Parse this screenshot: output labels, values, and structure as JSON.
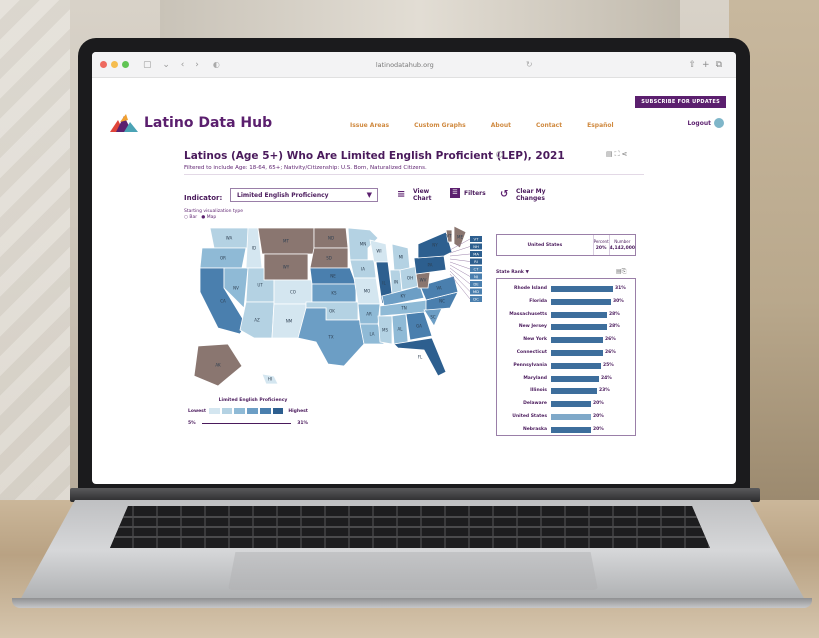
{
  "browser": {
    "url": "latinodatahub.org"
  },
  "site": {
    "subscribe_label": "SUBSCRIBE FOR UPDATES",
    "logo_text": "Latino Data Hub",
    "menu": [
      "Issue Areas",
      "Custom Graphs",
      "About",
      "Contact",
      "Español"
    ],
    "logout_label": "Logout"
  },
  "page": {
    "title": "Latinos (Age 5+) Who Are Limited English Proficient (LEP), 2021",
    "filtered": "Filtered to include Age: 18-64, 65+; Nativity/Citizenship: U.S. Born, Naturalized Citizens.",
    "indicator_label": "Indicator:",
    "indicator_value": "Limited English Proficiency",
    "view_chart_label": "View Chart",
    "filters_label": "Filters",
    "clear_label": "Clear My Changes",
    "vis_type_label": "Starting visualization type",
    "vis_options": [
      "Bar",
      "Map"
    ]
  },
  "legend": {
    "title": "Limited English Proficiency",
    "lowest": "Lowest",
    "highest": "Highest",
    "min": "5%",
    "max": "31%",
    "colors": [
      "#d4e6f0",
      "#b4d2e3",
      "#8fbad6",
      "#6c9ec5",
      "#4a7fae",
      "#2d5f8f"
    ]
  },
  "summary": {
    "label": "United States",
    "percent_header": "Percent",
    "number_header": "Number",
    "percent": "20%",
    "number": "4,142,000"
  },
  "ranking": {
    "header": "State Rank ▼",
    "rows": [
      {
        "label": "Rhode Island",
        "value": "31%",
        "pct": 31
      },
      {
        "label": "Florida",
        "value": "30%",
        "pct": 30
      },
      {
        "label": "Massachusetts",
        "value": "28%",
        "pct": 28
      },
      {
        "label": "New Jersey",
        "value": "28%",
        "pct": 28
      },
      {
        "label": "New York",
        "value": "26%",
        "pct": 26
      },
      {
        "label": "Connecticut",
        "value": "26%",
        "pct": 26
      },
      {
        "label": "Pennsylvania",
        "value": "25%",
        "pct": 25
      },
      {
        "label": "Maryland",
        "value": "24%",
        "pct": 24
      },
      {
        "label": "Illinois",
        "value": "23%",
        "pct": 23
      },
      {
        "label": "Delaware",
        "value": "20%",
        "pct": 20
      },
      {
        "label": "United States",
        "value": "20%",
        "pct": 20
      },
      {
        "label": "Nebraska",
        "value": "20%",
        "pct": 20
      }
    ]
  },
  "map_states": [
    {
      "id": "WA",
      "color": "#b4d2e3"
    },
    {
      "id": "OR",
      "color": "#8fbad6"
    },
    {
      "id": "CA",
      "color": "#4a7fae"
    },
    {
      "id": "NV",
      "color": "#8fbad6"
    },
    {
      "id": "ID",
      "color": "#d4e6f0"
    },
    {
      "id": "MT",
      "color": "#8a7670"
    },
    {
      "id": "WY",
      "color": "#8a7670"
    },
    {
      "id": "UT",
      "color": "#b4d2e3"
    },
    {
      "id": "AZ",
      "color": "#b4d2e3"
    },
    {
      "id": "CO",
      "color": "#d4e6f0"
    },
    {
      "id": "NM",
      "color": "#d4e6f0"
    },
    {
      "id": "ND",
      "color": "#8a7670"
    },
    {
      "id": "SD",
      "color": "#8a7670"
    },
    {
      "id": "NE",
      "color": "#4a7fae"
    },
    {
      "id": "KS",
      "color": "#6c9ec5"
    },
    {
      "id": "OK",
      "color": "#b4d2e3"
    },
    {
      "id": "TX",
      "color": "#6c9ec5"
    },
    {
      "id": "MN",
      "color": "#b4d2e3"
    },
    {
      "id": "IA",
      "color": "#b4d2e3"
    },
    {
      "id": "MO",
      "color": "#d4e6f0"
    },
    {
      "id": "AR",
      "color": "#8fbad6"
    },
    {
      "id": "LA",
      "color": "#8fbad6"
    },
    {
      "id": "WI",
      "color": "#d4e6f0"
    },
    {
      "id": "IL",
      "color": "#2d5f8f"
    },
    {
      "id": "MI",
      "color": "#b4d2e3"
    },
    {
      "id": "IN",
      "color": "#b4d2e3"
    },
    {
      "id": "OH",
      "color": "#b4d2e3"
    },
    {
      "id": "KY",
      "color": "#6c9ec5"
    },
    {
      "id": "TN",
      "color": "#8fbad6"
    },
    {
      "id": "MS",
      "color": "#b4d2e3"
    },
    {
      "id": "AL",
      "color": "#8fbad6"
    },
    {
      "id": "GA",
      "color": "#4a7fae"
    },
    {
      "id": "FL",
      "color": "#2d5f8f"
    },
    {
      "id": "SC",
      "color": "#6c9ec5"
    },
    {
      "id": "NC",
      "color": "#4a7fae"
    },
    {
      "id": "VA",
      "color": "#4a7fae"
    },
    {
      "id": "WV",
      "color": "#8a7670"
    },
    {
      "id": "PA",
      "color": "#2d5f8f"
    },
    {
      "id": "NY",
      "color": "#2d5f8f"
    },
    {
      "id": "VT",
      "color": "#8a7670"
    },
    {
      "id": "ME",
      "color": "#8a7670"
    },
    {
      "id": "AK",
      "color": "#8a7670"
    },
    {
      "id": "HI",
      "color": "#d4e6f0"
    }
  ],
  "ne_badges": [
    "VT",
    "NH",
    "MA",
    "RI",
    "CT",
    "NJ",
    "DE",
    "MD",
    "DC"
  ]
}
